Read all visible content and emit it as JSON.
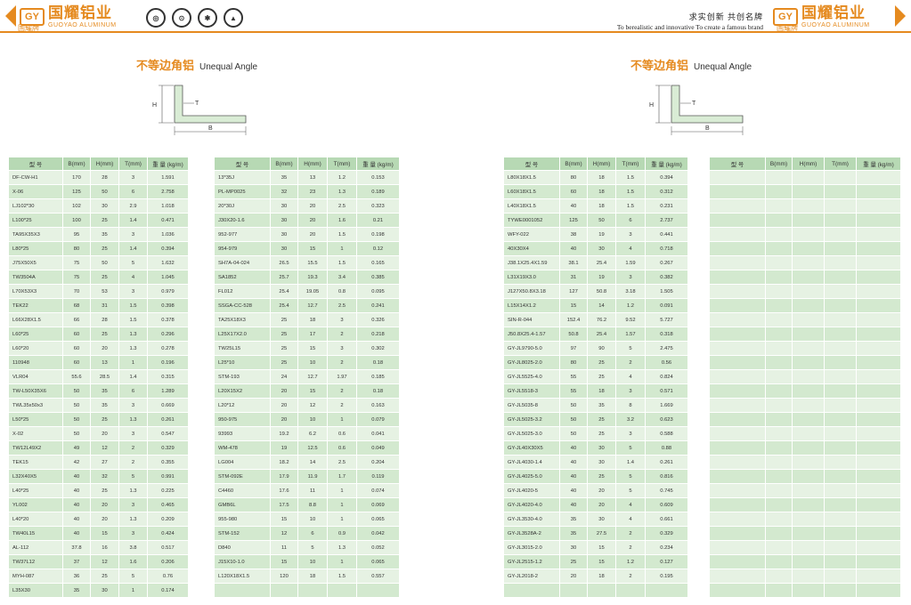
{
  "header": {
    "logo_mark": "GY",
    "logo_cn": "国耀铝业",
    "logo_en": "GUOYAO ALUMINUM",
    "brand_cn": "国耀牌",
    "slogan_cn": "求实创新  共创名牌",
    "slogan_en": "To berealistic and innovative   To create a famous brand",
    "accent": "#e58a1f"
  },
  "section": {
    "title_cn": "不等边角铝",
    "title_en": "Unequal Angle",
    "dim_h": "H",
    "dim_t": "T",
    "dim_b": "B"
  },
  "columns": [
    "型 号",
    "B(mm)",
    "H(mm)",
    "T(mm)",
    "重 量 (kg/m)"
  ],
  "tables": [
    {
      "rows": [
        [
          "DF-CW-H1",
          "170",
          "28",
          "3",
          "1.591"
        ],
        [
          "X-06",
          "125",
          "50",
          "6",
          "2.758"
        ],
        [
          "LJ102*30",
          "102",
          "30",
          "2.9",
          "1.018"
        ],
        [
          "L100*25",
          "100",
          "25",
          "1.4",
          "0.471"
        ],
        [
          "TA95X35X3",
          "95",
          "35",
          "3",
          "1.036"
        ],
        [
          "L80*25",
          "80",
          "25",
          "1.4",
          "0.394"
        ],
        [
          "J75X50X5",
          "75",
          "50",
          "5",
          "1.632"
        ],
        [
          "TW3504A",
          "75",
          "25",
          "4",
          "1.045"
        ],
        [
          "L70X53X3",
          "70",
          "53",
          "3",
          "0.979"
        ],
        [
          "TEK22",
          "68",
          "31",
          "1.5",
          "0.398"
        ],
        [
          "L66X28X1.5",
          "66",
          "28",
          "1.5",
          "0.378"
        ],
        [
          "L60*25",
          "60",
          "25",
          "1.3",
          "0.296"
        ],
        [
          "L60*20",
          "60",
          "20",
          "1.3",
          "0.278"
        ],
        [
          "110948",
          "60",
          "13",
          "1",
          "0.196"
        ],
        [
          "VLR04",
          "55.6",
          "28.5",
          "1.4",
          "0.315"
        ],
        [
          "TW-L50X35X6",
          "50",
          "35",
          "6",
          "1.289"
        ],
        [
          "TWL35x50x3",
          "50",
          "35",
          "3",
          "0.669"
        ],
        [
          "L50*25",
          "50",
          "25",
          "1.3",
          "0.261"
        ],
        [
          "X-02",
          "50",
          "20",
          "3",
          "0.547"
        ],
        [
          "TW12L49X2",
          "49",
          "12",
          "2",
          "0.329"
        ],
        [
          "TEK15",
          "42",
          "27",
          "2",
          "0.355"
        ],
        [
          "L32X40X5",
          "40",
          "32",
          "5",
          "0.991"
        ],
        [
          "L40*25",
          "40",
          "25",
          "1.3",
          "0.225"
        ],
        [
          "YL002",
          "40",
          "20",
          "3",
          "0.465"
        ],
        [
          "L40*20",
          "40",
          "20",
          "1.3",
          "0.209"
        ],
        [
          "TW40L15",
          "40",
          "15",
          "3",
          "0.424"
        ],
        [
          "AL-112",
          "37.8",
          "16",
          "3.8",
          "0.517"
        ],
        [
          "TW37L12",
          "37",
          "12",
          "1.6",
          "0.206"
        ],
        [
          "MYH-087",
          "36",
          "25",
          "5",
          "0.76"
        ],
        [
          "L35X30",
          "35",
          "30",
          "1",
          "0.174"
        ]
      ]
    },
    {
      "rows": [
        [
          "13*35J",
          "35",
          "13",
          "1.2",
          "0.153"
        ],
        [
          "PL-MP0025",
          "32",
          "23",
          "1.3",
          "0.189"
        ],
        [
          "20*30J",
          "30",
          "20",
          "2.5",
          "0.323"
        ],
        [
          "J30X20-1.6",
          "30",
          "20",
          "1.6",
          "0.21"
        ],
        [
          "952-977",
          "30",
          "20",
          "1.5",
          "0.198"
        ],
        [
          "954-979",
          "30",
          "15",
          "1",
          "0.12"
        ],
        [
          "SH7A-04-024",
          "26.5",
          "15.5",
          "1.5",
          "0.165"
        ],
        [
          "SA1852",
          "25.7",
          "19.3",
          "3.4",
          "0.385"
        ],
        [
          "FL012",
          "25.4",
          "19.05",
          "0.8",
          "0.095"
        ],
        [
          "SSGA-CC-528",
          "25.4",
          "12.7",
          "2.5",
          "0.241"
        ],
        [
          "TA25X18X3",
          "25",
          "18",
          "3",
          "0.326"
        ],
        [
          "L25X17X2.0",
          "25",
          "17",
          "2",
          "0.218"
        ],
        [
          "TW25L15",
          "25",
          "15",
          "3",
          "0.302"
        ],
        [
          "L25*10",
          "25",
          "10",
          "2",
          "0.18"
        ],
        [
          "STM-193",
          "24",
          "12.7",
          "1.97",
          "0.185"
        ],
        [
          "L20X15X2",
          "20",
          "15",
          "2",
          "0.18"
        ],
        [
          "L20*12",
          "20",
          "12",
          "2",
          "0.163"
        ],
        [
          "950-975",
          "20",
          "10",
          "1",
          "0.079"
        ],
        [
          "93993",
          "19.2",
          "6.2",
          "0.6",
          "0.041"
        ],
        [
          "WM-478",
          "19",
          "12.5",
          "0.6",
          "0.049"
        ],
        [
          "LG004",
          "18.2",
          "14",
          "2.5",
          "0.204"
        ],
        [
          "STM-092E",
          "17.9",
          "11.9",
          "1.7",
          "0.119"
        ],
        [
          "C4460",
          "17.6",
          "11",
          "1",
          "0.074"
        ],
        [
          "GMB6L",
          "17.5",
          "8.8",
          "1",
          "0.069"
        ],
        [
          "955-980",
          "15",
          "10",
          "1",
          "0.065"
        ],
        [
          "STM-152",
          "12",
          "6",
          "0.9",
          "0.042"
        ],
        [
          "D840",
          "11",
          "5",
          "1.3",
          "0.052"
        ],
        [
          "J15X10-1.0",
          "15",
          "10",
          "1",
          "0.065"
        ],
        [
          "L120X18X1.5",
          "120",
          "18",
          "1.5",
          "0.557"
        ],
        [
          "",
          "",
          "",
          "",
          ""
        ]
      ]
    },
    {
      "rows": [
        [
          "L80X18X1.5",
          "80",
          "18",
          "1.5",
          "0.394"
        ],
        [
          "L60X18X1.5",
          "60",
          "18",
          "1.5",
          "0.312"
        ],
        [
          "L40X18X1.5",
          "40",
          "18",
          "1.5",
          "0.231"
        ],
        [
          "TYWE0001052",
          "125",
          "50",
          "6",
          "2.737"
        ],
        [
          "WFY-022",
          "38",
          "19",
          "3",
          "0.441"
        ],
        [
          "40X30X4",
          "40",
          "30",
          "4",
          "0.718"
        ],
        [
          "J38.1X25.4X1.59",
          "38.1",
          "25.4",
          "1.59",
          "0.267"
        ],
        [
          "L31X19X3.0",
          "31",
          "19",
          "3",
          "0.382"
        ],
        [
          "J127X50.8X3.18",
          "127",
          "50.8",
          "3.18",
          "1.505"
        ],
        [
          "L15X14X1.2",
          "15",
          "14",
          "1.2",
          "0.091"
        ],
        [
          "SIN-R-044",
          "152.4",
          "76.2",
          "9.52",
          "5.727"
        ],
        [
          "J50.8X25.4-1.57",
          "50.8",
          "25.4",
          "1.57",
          "0.318"
        ],
        [
          "GY-JL9790-5.0",
          "97",
          "90",
          "5",
          "2.475"
        ],
        [
          "GY-JL8025-2.0",
          "80",
          "25",
          "2",
          "0.56"
        ],
        [
          "GY-JL5525-4.0",
          "55",
          "25",
          "4",
          "0.824"
        ],
        [
          "GY-JL5518-3",
          "55",
          "18",
          "3",
          "0.571"
        ],
        [
          "GY-JL5035-8",
          "50",
          "35",
          "8",
          "1.669"
        ],
        [
          "GY-JL5025-3.2",
          "50",
          "25",
          "3.2",
          "0.623"
        ],
        [
          "GY-JL5025-3.0",
          "50",
          "25",
          "3",
          "0.588"
        ],
        [
          "GY-JL40X30X5",
          "40",
          "30",
          "5",
          "0.88"
        ],
        [
          "GY-JL4030-1.4",
          "40",
          "30",
          "1.4",
          "0.261"
        ],
        [
          "GY-JL4025-5.0",
          "40",
          "25",
          "5",
          "0.816"
        ],
        [
          "GY-JL4020-5",
          "40",
          "20",
          "5",
          "0.745"
        ],
        [
          "GY-JL4020-4.0",
          "40",
          "20",
          "4",
          "0.609"
        ],
        [
          "GY-JL3530-4.0",
          "35",
          "30",
          "4",
          "0.661"
        ],
        [
          "GY-JL3528A-2",
          "35",
          "27.5",
          "2",
          "0.329"
        ],
        [
          "GY-JL3015-2.0",
          "30",
          "15",
          "2",
          "0.234"
        ],
        [
          "GY-JL2515-1.2",
          "25",
          "15",
          "1.2",
          "0.127"
        ],
        [
          "GY-JL2018-2",
          "20",
          "18",
          "2",
          "0.195"
        ],
        [
          "",
          "",
          "",
          "",
          ""
        ]
      ]
    },
    {
      "rows": [
        [
          "",
          "",
          "",
          "",
          ""
        ],
        [
          "",
          "",
          "",
          "",
          ""
        ],
        [
          "",
          "",
          "",
          "",
          ""
        ],
        [
          "",
          "",
          "",
          "",
          ""
        ],
        [
          "",
          "",
          "",
          "",
          ""
        ],
        [
          "",
          "",
          "",
          "",
          ""
        ],
        [
          "",
          "",
          "",
          "",
          ""
        ],
        [
          "",
          "",
          "",
          "",
          ""
        ],
        [
          "",
          "",
          "",
          "",
          ""
        ],
        [
          "",
          "",
          "",
          "",
          ""
        ],
        [
          "",
          "",
          "",
          "",
          ""
        ],
        [
          "",
          "",
          "",
          "",
          ""
        ],
        [
          "",
          "",
          "",
          "",
          ""
        ],
        [
          "",
          "",
          "",
          "",
          ""
        ],
        [
          "",
          "",
          "",
          "",
          ""
        ],
        [
          "",
          "",
          "",
          "",
          ""
        ],
        [
          "",
          "",
          "",
          "",
          ""
        ],
        [
          "",
          "",
          "",
          "",
          ""
        ],
        [
          "",
          "",
          "",
          "",
          ""
        ],
        [
          "",
          "",
          "",
          "",
          ""
        ],
        [
          "",
          "",
          "",
          "",
          ""
        ],
        [
          "",
          "",
          "",
          "",
          ""
        ],
        [
          "",
          "",
          "",
          "",
          ""
        ],
        [
          "",
          "",
          "",
          "",
          ""
        ],
        [
          "",
          "",
          "",
          "",
          ""
        ],
        [
          "",
          "",
          "",
          "",
          ""
        ],
        [
          "",
          "",
          "",
          "",
          ""
        ],
        [
          "",
          "",
          "",
          "",
          ""
        ],
        [
          "",
          "",
          "",
          "",
          ""
        ],
        [
          "",
          "",
          "",
          "",
          ""
        ]
      ]
    }
  ]
}
